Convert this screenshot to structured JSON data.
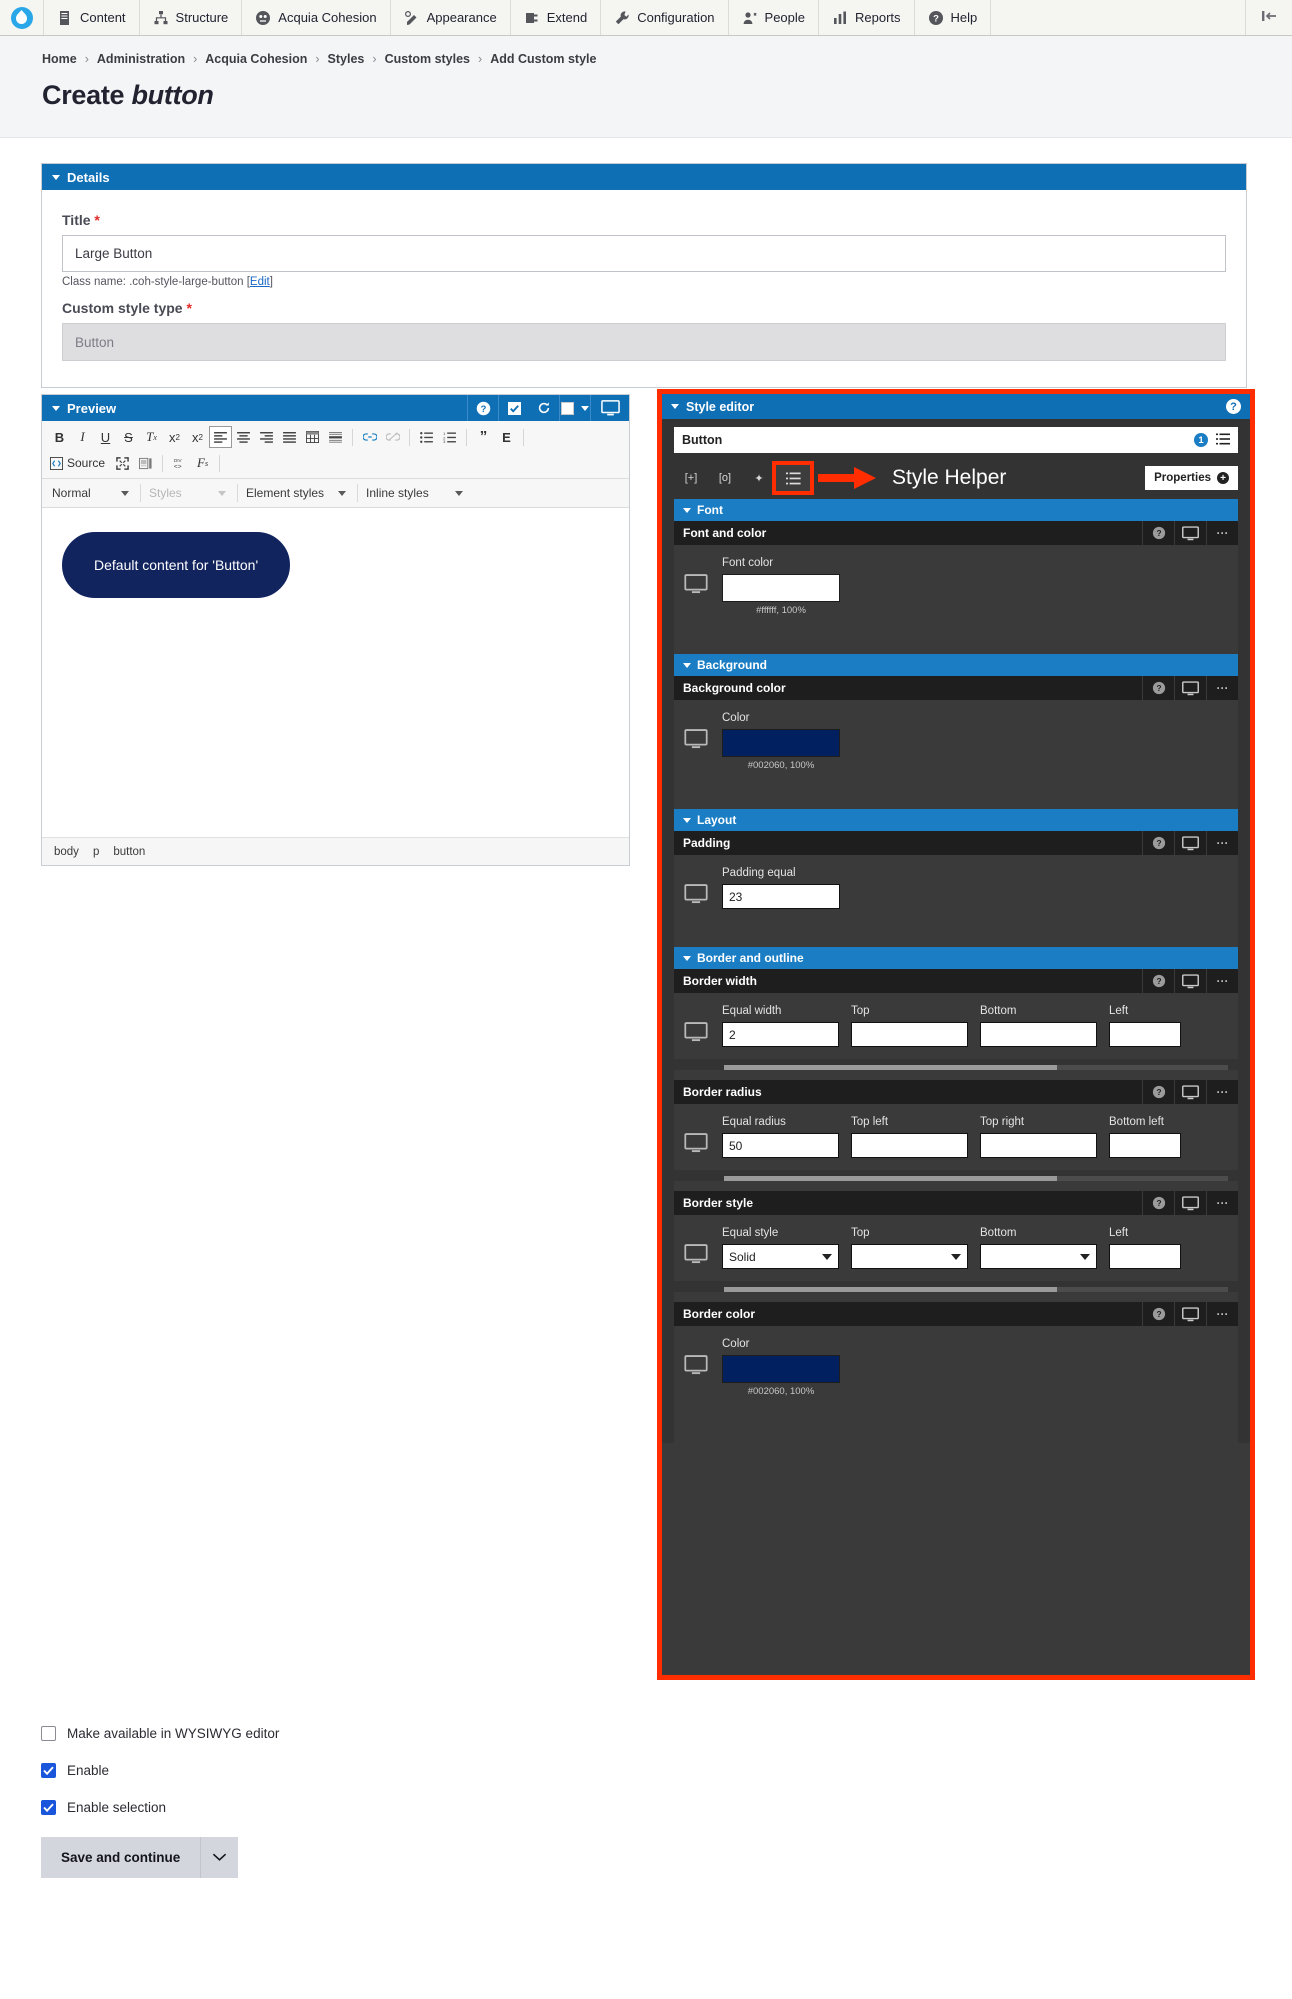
{
  "toolbar": {
    "logo_name": "drupal-logo",
    "items": [
      {
        "label": "Content",
        "icon": "content-icon"
      },
      {
        "label": "Structure",
        "icon": "structure-icon"
      },
      {
        "label": "Acquia Cohesion",
        "icon": "acquia-cohesion-icon"
      },
      {
        "label": "Appearance",
        "icon": "appearance-icon"
      },
      {
        "label": "Extend",
        "icon": "extend-icon"
      },
      {
        "label": "Configuration",
        "icon": "configuration-icon"
      },
      {
        "label": "People",
        "icon": "people-icon"
      },
      {
        "label": "Reports",
        "icon": "reports-icon"
      },
      {
        "label": "Help",
        "icon": "help-icon"
      }
    ],
    "collapse_label": "collapse-toolbar-icon"
  },
  "header": {
    "breadcrumb": [
      "Home",
      "Administration",
      "Acquia Cohesion",
      "Styles",
      "Custom styles",
      "Add Custom style"
    ],
    "title_prefix": "Create ",
    "title_emphasis": "button"
  },
  "details": {
    "panel_title": "Details",
    "title_label": "Title",
    "title_required": "*",
    "title_value": "Large Button",
    "title_placeholder": "Title",
    "class_name_text": "Class name: .coh-style-large-button [",
    "class_name_edit": "Edit",
    "class_name_close": "]",
    "style_type_label": "Custom style type",
    "style_type_required": "*",
    "style_type_value": "Button"
  },
  "preview": {
    "panel_title": "Preview",
    "header_icons": [
      "help-icon",
      "checkbox-icon",
      "refresh-icon",
      "color-swatch-icon",
      "desktop-icon"
    ],
    "toolbar_row1": [
      {
        "name": "bold-icon",
        "glyph": "B"
      },
      {
        "name": "italic-icon",
        "glyph": "I"
      },
      {
        "name": "underline-icon",
        "glyph": "U"
      },
      {
        "name": "strikethrough-icon",
        "glyph": "S"
      },
      {
        "name": "remove-format-icon",
        "glyph": "Tx"
      },
      {
        "name": "superscript-icon",
        "glyph": "x²"
      },
      {
        "name": "subscript-icon",
        "glyph": "x₂"
      }
    ],
    "toolbar_align": [
      {
        "name": "align-left-icon"
      },
      {
        "name": "align-center-icon"
      },
      {
        "name": "align-right-icon"
      },
      {
        "name": "align-justify-icon"
      },
      {
        "name": "table-icon"
      },
      {
        "name": "horizontal-rule-icon"
      }
    ],
    "toolbar_links": [
      {
        "name": "link-icon"
      },
      {
        "name": "unlink-icon"
      }
    ],
    "toolbar_lists": [
      {
        "name": "bulleted-list-icon"
      },
      {
        "name": "numbered-list-icon"
      }
    ],
    "toolbar_quote": [
      {
        "name": "blockquote-icon",
        "glyph": "”"
      },
      {
        "name": "text-element-icon",
        "glyph": "E"
      }
    ],
    "toolbar_row2": {
      "source_label": "Source",
      "buttons": [
        {
          "name": "maximize-icon"
        },
        {
          "name": "image-icon"
        },
        {
          "name": "div-container-icon",
          "glyph": "DIV"
        },
        {
          "name": "styles-icon",
          "glyph": "Fs"
        }
      ]
    },
    "combos": [
      {
        "name": "paragraph-format-select",
        "label": "Normal",
        "muted": false
      },
      {
        "name": "styles-select",
        "label": "Styles",
        "muted": true
      },
      {
        "name": "element-styles-select",
        "label": "Element styles",
        "muted": false
      },
      {
        "name": "inline-styles-select",
        "label": "Inline styles",
        "muted": false
      }
    ],
    "canvas_button_label": "Default content for 'Button'",
    "canvas_button_bg": "#12245e",
    "canvas_button_color": "#ffffff",
    "status_path": [
      "body",
      "p",
      "button"
    ]
  },
  "style_editor": {
    "panel_title": "Style editor",
    "help_icon": "help-icon",
    "element_name": "Button",
    "element_badge": "1",
    "element_menu_icon": "list-menu-icon",
    "toolbar_buttons": [
      {
        "name": "add-style-icon",
        "glyph": "[+]"
      },
      {
        "name": "search-style-icon",
        "glyph": "[o]"
      },
      {
        "name": "magic-style-icon",
        "glyph": "✦"
      },
      {
        "name": "style-helper-icon",
        "glyph": "☰",
        "highlighted": true
      }
    ],
    "annotation_label": "Style Helper",
    "annotation_arrow": "red-arrow-icon",
    "properties_label": "Properties",
    "sections": [
      {
        "name": "Font",
        "groups": [
          {
            "title": "Font and color",
            "actions": [
              "help-icon",
              "desktop-icon",
              "more-options-icon"
            ],
            "scroll": false,
            "fields": [
              {
                "type": "color",
                "label": "Font color",
                "value": "#ffffff",
                "caption": "#ffffff, 100%"
              }
            ]
          }
        ]
      },
      {
        "name": "Background",
        "groups": [
          {
            "title": "Background color",
            "actions": [
              "help-icon",
              "desktop-icon",
              "more-options-icon"
            ],
            "scroll": false,
            "fields": [
              {
                "type": "color",
                "label": "Color",
                "value": "#002060",
                "caption": "#002060, 100%"
              }
            ]
          }
        ]
      },
      {
        "name": "Layout",
        "groups": [
          {
            "title": "Padding",
            "actions": [
              "help-icon",
              "desktop-icon",
              "more-options-icon"
            ],
            "scroll": false,
            "fields": [
              {
                "type": "text",
                "label": "Padding equal",
                "value": "23"
              }
            ]
          }
        ]
      },
      {
        "name": "Border and outline",
        "groups": [
          {
            "title": "Border width",
            "actions": [
              "help-icon",
              "desktop-icon",
              "more-options-icon"
            ],
            "scroll": true,
            "fields": [
              {
                "type": "text",
                "label": "Equal width",
                "value": "2"
              },
              {
                "type": "text",
                "label": "Top",
                "value": ""
              },
              {
                "type": "text",
                "label": "Bottom",
                "value": ""
              },
              {
                "type": "text",
                "label": "Left",
                "value": ""
              }
            ]
          },
          {
            "title": "Border radius",
            "actions": [
              "help-icon",
              "desktop-icon",
              "more-options-icon"
            ],
            "scroll": true,
            "fields": [
              {
                "type": "text",
                "label": "Equal radius",
                "value": "50"
              },
              {
                "type": "text",
                "label": "Top left",
                "value": ""
              },
              {
                "type": "text",
                "label": "Top right",
                "value": ""
              },
              {
                "type": "text",
                "label": "Bottom left",
                "value": ""
              }
            ]
          },
          {
            "title": "Border style",
            "actions": [
              "help-icon",
              "desktop-icon",
              "more-options-icon"
            ],
            "scroll": true,
            "fields": [
              {
                "type": "select",
                "label": "Equal style",
                "value": "Solid"
              },
              {
                "type": "select",
                "label": "Top",
                "value": ""
              },
              {
                "type": "select",
                "label": "Bottom",
                "value": ""
              },
              {
                "type": "text",
                "label": "Left",
                "value": ""
              }
            ]
          },
          {
            "title": "Border color",
            "actions": [
              "help-icon",
              "desktop-icon",
              "more-options-icon"
            ],
            "scroll": false,
            "fields": [
              {
                "type": "color",
                "label": "Color",
                "value": "#002060",
                "caption": "#002060, 100%"
              }
            ]
          }
        ]
      }
    ]
  },
  "form_footer": {
    "checkboxes": [
      {
        "label": "Make available in WYSIWYG editor",
        "checked": false,
        "name": "wysiwyg-checkbox"
      },
      {
        "label": "Enable",
        "checked": true,
        "name": "enable-checkbox"
      },
      {
        "label": "Enable selection",
        "checked": true,
        "name": "enable-selection-checkbox"
      }
    ],
    "save_label": "Save and continue",
    "save_dropdown_icon": "chevron-down-icon"
  },
  "colors": {
    "panel_blue": "#0f6fb5",
    "section_blue": "#1b7ec4",
    "highlight_red": "#ff2d00",
    "editor_bg": "#3a3a3a",
    "sub_head_bg": "#1e1e1e",
    "accent_blue": "#1a56db"
  }
}
